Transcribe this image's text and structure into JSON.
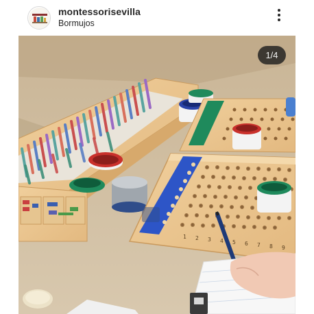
{
  "post": {
    "username": "montessorisevilla",
    "location": "Bormujos",
    "media_counter": "1/4",
    "more_icon": "more-vertical-icon"
  },
  "board": {
    "numbers": [
      "1",
      "2",
      "3",
      "4",
      "5",
      "6",
      "7",
      "8",
      "9"
    ]
  }
}
